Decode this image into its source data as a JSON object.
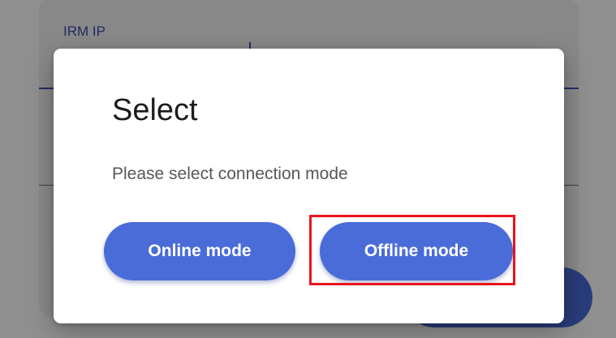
{
  "background": {
    "field_label": "IRM IP"
  },
  "dialog": {
    "title": "Select",
    "message": "Please select connection mode",
    "buttons": {
      "online_label": "Online mode",
      "offline_label": "Offline mode"
    }
  },
  "colors": {
    "accent": "#4a6cd9",
    "highlight": "#e8141c",
    "field_underline": "#3f51b5"
  }
}
